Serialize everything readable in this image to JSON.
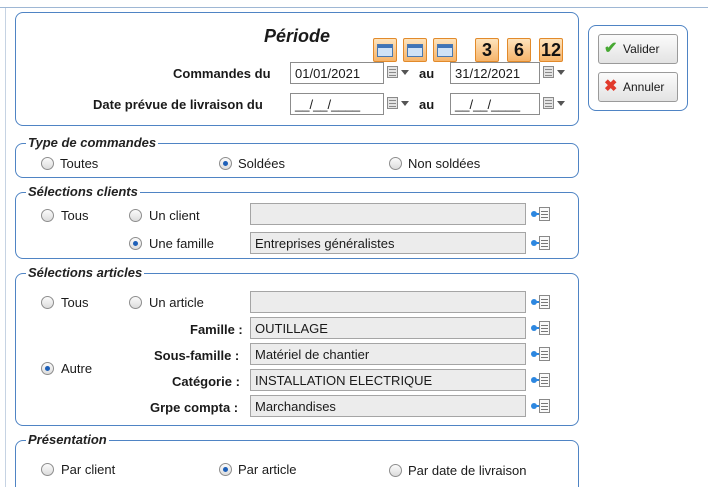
{
  "periode": {
    "title": "Période",
    "period_buttons": [
      {
        "name": "period-week-button",
        "icon": "calendar-week-icon",
        "label": ""
      },
      {
        "name": "period-month-button",
        "icon": "calendar-month-icon",
        "label": ""
      },
      {
        "name": "period-year-button",
        "icon": "calendar-year-icon",
        "label": ""
      },
      {
        "name": "period-3-months-button",
        "icon": "",
        "label": "3"
      },
      {
        "name": "period-6-months-button",
        "icon": "",
        "label": "6"
      },
      {
        "name": "period-12-months-button",
        "icon": "",
        "label": "12"
      }
    ],
    "commandes_label": "Commandes du",
    "commandes_from": "01/01/2021",
    "au_label": "au",
    "commandes_to": "31/12/2021",
    "livraison_label": "Date prévue de livraison du",
    "livraison_from": "__/__/____",
    "livraison_to": "__/__/____"
  },
  "type_commandes": {
    "legend": "Type de commandes",
    "options": [
      "Toutes",
      "Soldées",
      "Non soldées"
    ],
    "selected": "Soldées"
  },
  "selections_clients": {
    "legend": "Sélections clients",
    "opt_tous": "Tous",
    "opt_un_client": "Un client",
    "opt_une_famille": "Une famille",
    "selected": "Une famille",
    "client_value": "",
    "famille_value": "Entreprises généralistes"
  },
  "selections_articles": {
    "legend": "Sélections articles",
    "opt_tous": "Tous",
    "opt_un_article": "Un article",
    "opt_autre": "Autre",
    "selected": "Autre",
    "article_value": "",
    "famille_label": "Famille :",
    "famille_value": "OUTILLAGE",
    "sous_famille_label": "Sous-famille :",
    "sous_famille_value": "Matériel de chantier",
    "categorie_label": "Catégorie :",
    "categorie_value": "INSTALLATION ELECTRIQUE",
    "grpe_compta_label": "Grpe compta :",
    "grpe_compta_value": "Marchandises"
  },
  "presentation": {
    "legend": "Présentation",
    "options": [
      "Par client",
      "Par article",
      "Par date de livraison"
    ],
    "selected": "Par article"
  },
  "actions": {
    "valider_label": "Valider",
    "valider_icon": "checkmark-icon",
    "annuler_label": "Annuler",
    "annuler_icon": "cross-icon"
  },
  "colors": {
    "frame_border": "#4f84c4",
    "period_button": "#f6b46a",
    "radio_selected": "#1d5fb8",
    "pick_icon": "#2d87e0"
  }
}
